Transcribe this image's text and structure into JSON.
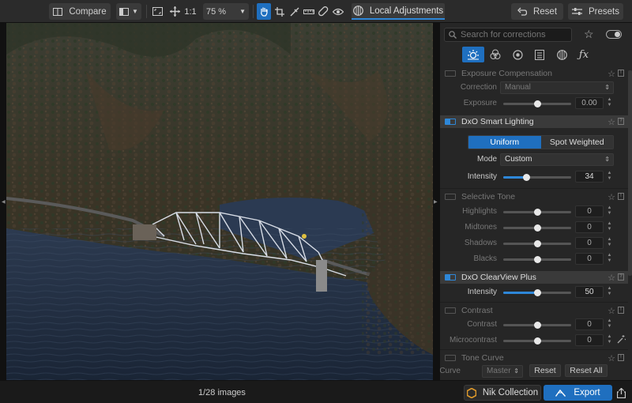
{
  "toolbar": {
    "compare_label": "Compare",
    "zoom_fit": "1:1",
    "zoom_value": "75 %",
    "local_adjustments_label": "Local Adjustments",
    "reset_label": "Reset",
    "presets_label": "Presets"
  },
  "panel": {
    "search_placeholder": "Search for corrections",
    "sections": {
      "exposure": {
        "title": "Exposure Compensation",
        "correction_label": "Correction",
        "correction_value": "Manual",
        "exposure_label": "Exposure",
        "exposure_value": "0.00",
        "exposure_level": 0.5
      },
      "smart_lighting": {
        "title": "DxO Smart Lighting",
        "mode_uniform": "Uniform",
        "mode_spot": "Spot Weighted",
        "mode_label": "Mode",
        "mode_value": "Custom",
        "intensity_label": "Intensity",
        "intensity_value": "34",
        "intensity_level": 0.34
      },
      "selective_tone": {
        "title": "Selective Tone",
        "rows": [
          {
            "label": "Highlights",
            "value": "0"
          },
          {
            "label": "Midtones",
            "value": "0"
          },
          {
            "label": "Shadows",
            "value": "0"
          },
          {
            "label": "Blacks",
            "value": "0"
          }
        ]
      },
      "clearview": {
        "title": "DxO ClearView Plus",
        "intensity_label": "Intensity",
        "intensity_value": "50",
        "intensity_level": 0.5
      },
      "contrast": {
        "title": "Contrast",
        "rows": [
          {
            "label": "Contrast",
            "value": "0"
          },
          {
            "label": "Microcontrast",
            "value": "0"
          }
        ]
      },
      "tone_curve": {
        "title": "Tone Curve",
        "curve_label": "Curve",
        "curve_value": "Master",
        "reset_label": "Reset",
        "reset_all_label": "Reset All"
      }
    }
  },
  "bottom": {
    "image_count": "1/28 images",
    "nik_label": "Nik Collection",
    "export_label": "Export"
  },
  "colors": {
    "accent": "#1f6fbf",
    "panel_bg": "#262626",
    "toolbar_bg": "#2b2b2b"
  }
}
